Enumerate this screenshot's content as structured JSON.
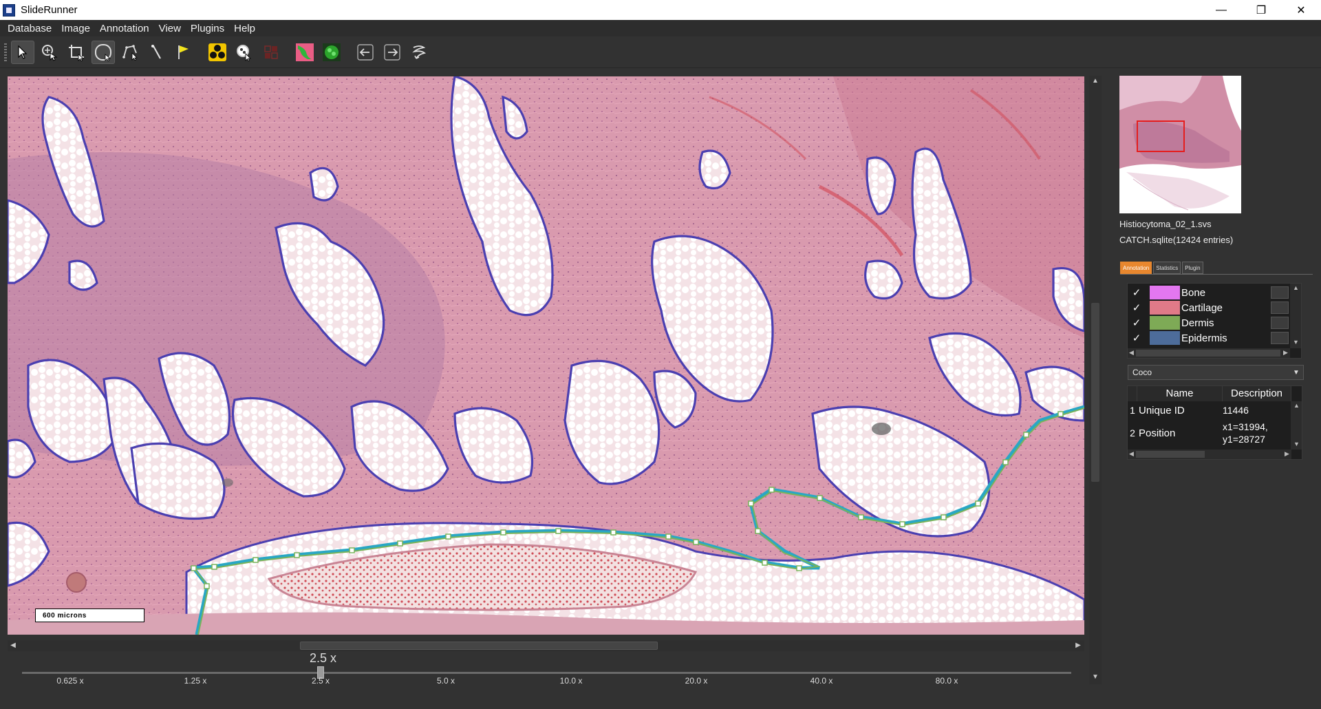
{
  "window": {
    "title": "SlideRunner",
    "minimize": "—",
    "restore": "❐",
    "close": "✕"
  },
  "menu": [
    "Database",
    "Image",
    "Annotation",
    "View",
    "Plugins",
    "Help"
  ],
  "toolbar": {
    "tools": [
      "arrow-pointer-icon",
      "zoom-select-icon",
      "crop-icon",
      "circle-annotation-icon",
      "polygon-annotation-icon",
      "wand-icon",
      "flag-icon",
      "cells-icon",
      "zoom-cells-icon",
      "grid-icon",
      "overlay-toggle-icon",
      "heatmap-icon",
      "back-arrow-icon",
      "forward-arrow-icon",
      "cursor-swirl-icon"
    ]
  },
  "viewer": {
    "scalebar_label": "600 microns"
  },
  "zoom": {
    "current": "2.5 x",
    "ticks": [
      "0.625 x",
      "1.25 x",
      "2.5 x",
      "5.0 x",
      "10.0 x",
      "20.0 x",
      "40.0 x",
      "80.0 x"
    ]
  },
  "sidebar": {
    "filename": "Histiocytoma_02_1.svs",
    "database": "CATCH.sqlite(12424 entries)",
    "tabs": [
      "Annotation",
      "Statistics",
      "Plugin"
    ],
    "classes": [
      {
        "name": "Bone",
        "color": "#e377f0",
        "checked": "✓"
      },
      {
        "name": "Cartilage",
        "color": "#e07a88",
        "checked": "✓"
      },
      {
        "name": "Dermis",
        "color": "#7eaa56",
        "checked": "✓"
      },
      {
        "name": "Epidermis",
        "color": "#4d6c9a",
        "checked": "✓"
      }
    ],
    "class_set": "Coco",
    "properties": {
      "headers": [
        "Name",
        "Description"
      ],
      "rows": [
        {
          "index": "1",
          "name": "Unique ID",
          "value": "11446"
        },
        {
          "index": "2",
          "name": "Position",
          "value": "x1=31994, y1=28727"
        }
      ]
    }
  },
  "colors": {
    "fat_outline": "#4b3fb0",
    "selected_outline": "#2aa7c4",
    "selected_inner": "#79b35a",
    "tissue": "#d99aae"
  }
}
